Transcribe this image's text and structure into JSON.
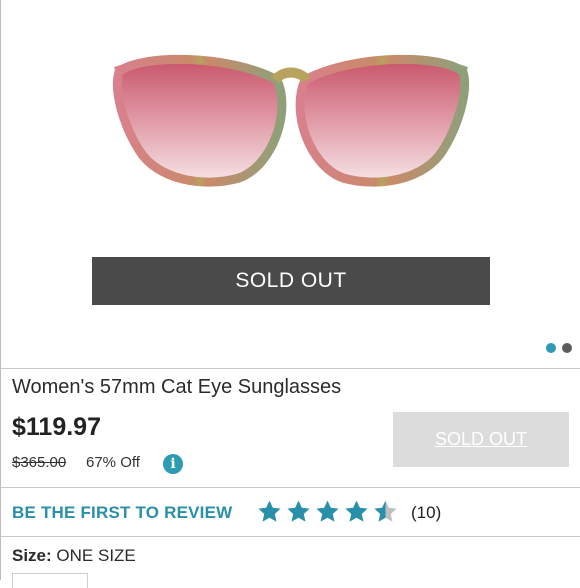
{
  "hero": {
    "overlay_label": "SOLD OUT",
    "carousel": {
      "count": 2,
      "active_index": 0,
      "active_color": "#2d9bb5",
      "inactive_color": "#5a5a5a"
    }
  },
  "product": {
    "title": "Women's 57mm Cat Eye Sunglasses",
    "price": "$119.97",
    "original_price": "$365.00",
    "discount": "67% Off",
    "info_icon": "info-icon",
    "cta_label": "SOLD OUT"
  },
  "reviews": {
    "link_label": "BE THE FIRST TO REVIEW",
    "rating": 4.5,
    "max_rating": 5,
    "count_label": "(10)",
    "star_color": "#2a8fa8"
  },
  "size": {
    "label": "Size:",
    "value": "ONE SIZE"
  }
}
